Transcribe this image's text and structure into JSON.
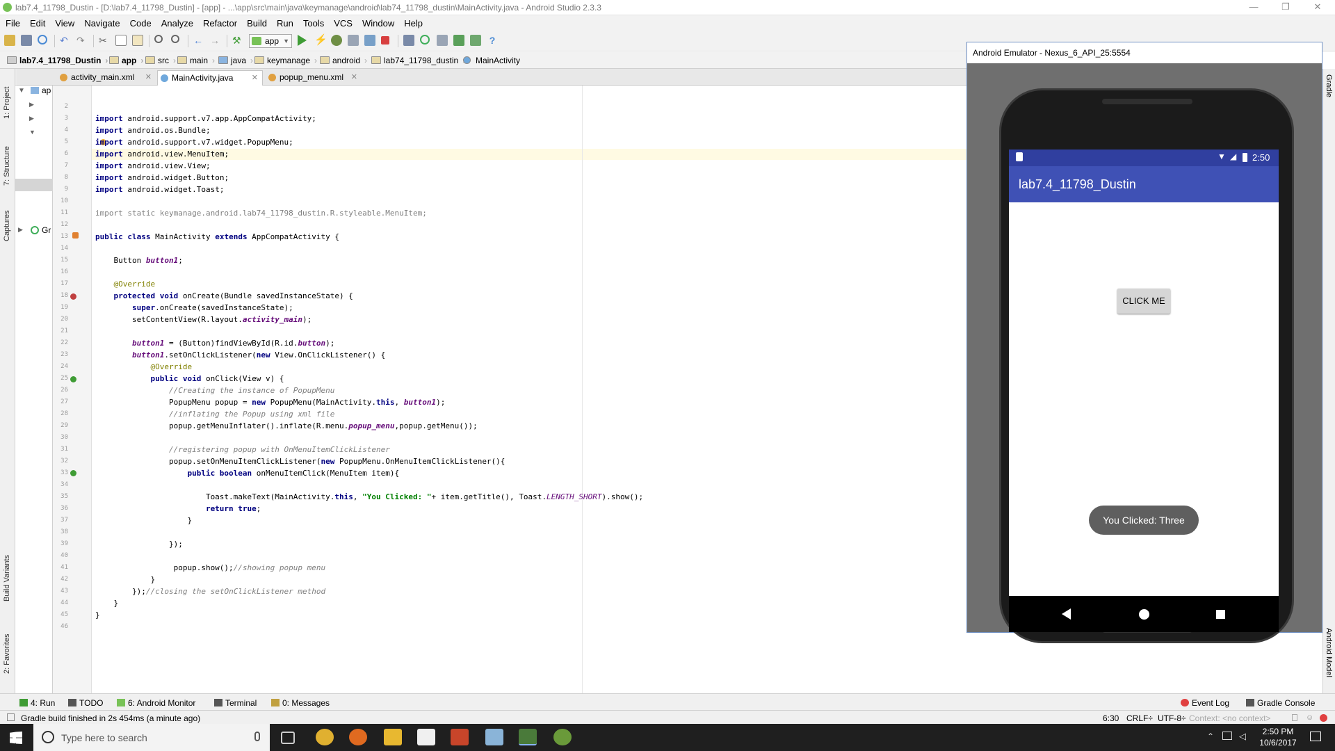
{
  "window": {
    "title": "lab7.4_11798_Dustin - [D:\\lab7.4_11798_Dustin] - [app] - ...\\app\\src\\main\\java\\keymanage\\android\\lab74_11798_dustin\\MainActivity.java - Android Studio 2.3.3",
    "minimize": "—",
    "maximize": "❐",
    "close": "✕"
  },
  "menu": [
    "File",
    "Edit",
    "View",
    "Navigate",
    "Code",
    "Analyze",
    "Refactor",
    "Build",
    "Run",
    "Tools",
    "VCS",
    "Window",
    "Help"
  ],
  "toolbar": {
    "run_config": "app",
    "help": "?"
  },
  "breadcrumb": [
    "lab7.4_11798_Dustin",
    "app",
    "src",
    "main",
    "java",
    "keymanage",
    "android",
    "lab74_11798_dustin",
    "MainActivity"
  ],
  "tabs": [
    {
      "label": "activity_main.xml",
      "active": false
    },
    {
      "label": "MainActivity.java",
      "active": true
    },
    {
      "label": "popup_menu.xml",
      "active": false
    }
  ],
  "left_tools": [
    "1: Project",
    "7: Structure",
    "Captures",
    "Build Variants",
    "2: Favorites"
  ],
  "project_tree": {
    "root": "ap",
    "gradle": "Gr"
  },
  "line_numbers": [
    "2",
    "3",
    "4",
    "5",
    "6",
    "7",
    "8",
    "9",
    "10",
    "11",
    "12",
    "13",
    "14",
    "15",
    "16",
    "17",
    "18",
    "19",
    "20",
    "21",
    "22",
    "23",
    "24",
    "25",
    "26",
    "27",
    "28",
    "29",
    "30",
    "31",
    "32",
    "33",
    "34",
    "35",
    "36",
    "37",
    "38",
    "39",
    "40",
    "41",
    "42",
    "43",
    "44",
    "45",
    "46"
  ],
  "code": {
    "l3": [
      "import",
      " android.support.v7.app.AppCompatActivity;"
    ],
    "l4": [
      "import",
      " android.os.Bundle;"
    ],
    "l5": [
      "import",
      " android.support.v7.widget.PopupMenu;"
    ],
    "l6": [
      "import",
      " android.view.MenuItem;"
    ],
    "l7": [
      "import",
      " android.view.View;"
    ],
    "l8": [
      "import",
      " android.widget.Button;"
    ],
    "l9": [
      "import",
      " android.widget.Toast;"
    ],
    "l11": "import static keymanage.android.lab74_11798_dustin.R.styleable.MenuItem;",
    "l13": [
      "public class",
      " MainActivity ",
      "extends",
      " AppCompatActivity {"
    ],
    "l15": [
      "    Button ",
      "button1",
      ";"
    ],
    "l17": "    @Override",
    "l18": [
      "    protected void",
      " onCreate(Bundle savedInstanceState) {"
    ],
    "l19": [
      "        super",
      ".onCreate(savedInstanceState);"
    ],
    "l20": [
      "        setContentView(R.layout.",
      "activity_main",
      ");"
    ],
    "l22": [
      "        ",
      "button1",
      " = (Button)findViewById(R.id.",
      "button",
      ");"
    ],
    "l23": [
      "        ",
      "button1",
      ".setOnClickListener(",
      "new",
      " View.OnClickListener() {"
    ],
    "l24": "            @Override",
    "l25": [
      "            public void",
      " onClick(View v) {"
    ],
    "l26": "                //Creating the instance of PopupMenu",
    "l27": [
      "                PopupMenu popup = ",
      "new",
      " PopupMenu(MainActivity.",
      "this",
      ", ",
      "button1",
      ");"
    ],
    "l28": "                //inflating the Popup using xml file",
    "l29": [
      "                popup.getMenuInflater().inflate(R.menu.",
      "popup_menu",
      ",popup.getMenu());"
    ],
    "l31": "                //registering popup with OnMenuItemClickListener",
    "l32": [
      "                popup.setOnMenuItemClickListener(",
      "new",
      " PopupMenu.OnMenuItemClickListener(){"
    ],
    "l33": [
      "                    public boolean",
      " onMenuItemClick(MenuItem item){"
    ],
    "l35": [
      "                        Toast.makeText(MainActivity.",
      "this",
      ", ",
      "\"You Clicked: \"",
      "+ item.getTitle(), Toast.",
      "LENGTH_SHORT",
      ").show();"
    ],
    "l36": [
      "                        return true",
      ";"
    ],
    "l37": "                    }",
    "l39": "                });",
    "l41": [
      "                 popup.show();",
      "//showing popup menu"
    ],
    "l42": "            }",
    "l43": [
      "        });",
      "//closing the setOnClickListener method"
    ],
    "l44": "    }",
    "l45": "}"
  },
  "emulator": {
    "window_title": "Android Emulator - Nexus_6_API_25:5554",
    "time": "2:50",
    "app_title": "lab7.4_11798_Dustin",
    "button_label": "CLICK ME",
    "toast": "You Clicked: Three"
  },
  "right_tools": [
    "Gradle",
    "Android Model"
  ],
  "bottom_tools": [
    {
      "label": "4: Run",
      "color": "#3f9c35"
    },
    {
      "label": "TODO",
      "color": "#555555"
    },
    {
      "label": "6: Android Monitor",
      "color": "#78c257"
    },
    {
      "label": "Terminal",
      "color": "#555555"
    },
    {
      "label": "0: Messages",
      "color": "#c0a040"
    }
  ],
  "bottom_right_tools": [
    {
      "label": "Event Log",
      "color": "#e04040"
    },
    {
      "label": "Gradle Console",
      "color": "#555555"
    }
  ],
  "status": {
    "message": "Gradle build finished in 2s 454ms (a minute ago)",
    "position": "6:30",
    "line_sep": "CRLF÷",
    "encoding": "UTF-8÷",
    "context": "Context: <no context>"
  },
  "taskbar": {
    "search_placeholder": "Type here to search",
    "time": "2:50 PM",
    "date": "10/6/2017"
  },
  "colors": {
    "android_primary": "#3f51b5",
    "android_primary_dark": "#303f9f",
    "keyword": "#000080",
    "string": "#008000",
    "comment": "#808080",
    "annotation": "#808000",
    "field": "#660e7a"
  }
}
